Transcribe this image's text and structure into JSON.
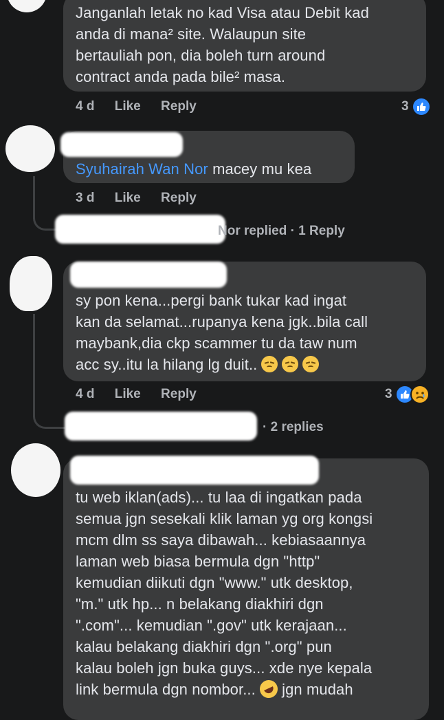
{
  "comments": [
    {
      "lines": [
        "Janganlah letak no kad Visa atau Debit kad",
        "anda di mana² site. Walaupun site",
        "bertauliah pon, dia boleh turn around",
        "contract anda pada bile² masa."
      ],
      "time": "4 d",
      "like_label": "Like",
      "reply_label": "Reply",
      "reactions": {
        "count": "3",
        "icons": [
          "like-icon"
        ]
      }
    },
    {
      "mention": "Syuhairah Wan Nor",
      "text_after_mention": " macey mu kea",
      "time": "3 d",
      "like_label": "Like",
      "reply_label": "Reply",
      "replies_summary": "Nor replied · 1 Reply"
    },
    {
      "lines": [
        "sy pon kena...pergi bank tukar kad ingat",
        "kan da selamat...rupanya kena jgk..bila call",
        "maybank,dia ckp scammer tu da taw num",
        "acc sy..itu la hilang lg duit.."
      ],
      "trailing_emojis": [
        "pensive-face",
        "pensive-face",
        "pensive-face"
      ],
      "time": "4 d",
      "like_label": "Like",
      "reply_label": "Reply",
      "reactions": {
        "count": "3",
        "icons": [
          "like-icon",
          "sad-icon"
        ]
      },
      "replies_summary": "· 2 replies"
    },
    {
      "lines": [
        "tu web iklan(ads)... tu laa di ingatkan pada",
        "semua jgn sesekali klik laman yg org kongsi",
        "mcm dlm ss saya dibawah... kebiasaannya",
        "laman web biasa bermula dgn \"http\"",
        "kemudian diikuti dgn \"www.\" utk desktop,",
        "\"m.\" utk hp... n belakang diakhiri dgn",
        "\".com\"... kemudian \".gov\" utk kerajaan...",
        "kalau belakang diakhiri dgn \".org\" pun",
        "kalau boleh jgn buka guys... xde nye kepala",
        "link bermula dgn nombor..."
      ],
      "last_line_after_emoji": "jgn mudah",
      "inline_emoji": "rolling-on-floor-laughing"
    }
  ],
  "colors": {
    "background": "#18191a",
    "bubble": "#3a3b3c",
    "text": "#e4e6eb",
    "secondary": "#b0b3b8",
    "mention": "#4599ff",
    "like": "#2d88ff",
    "sad": "#f7b125"
  }
}
